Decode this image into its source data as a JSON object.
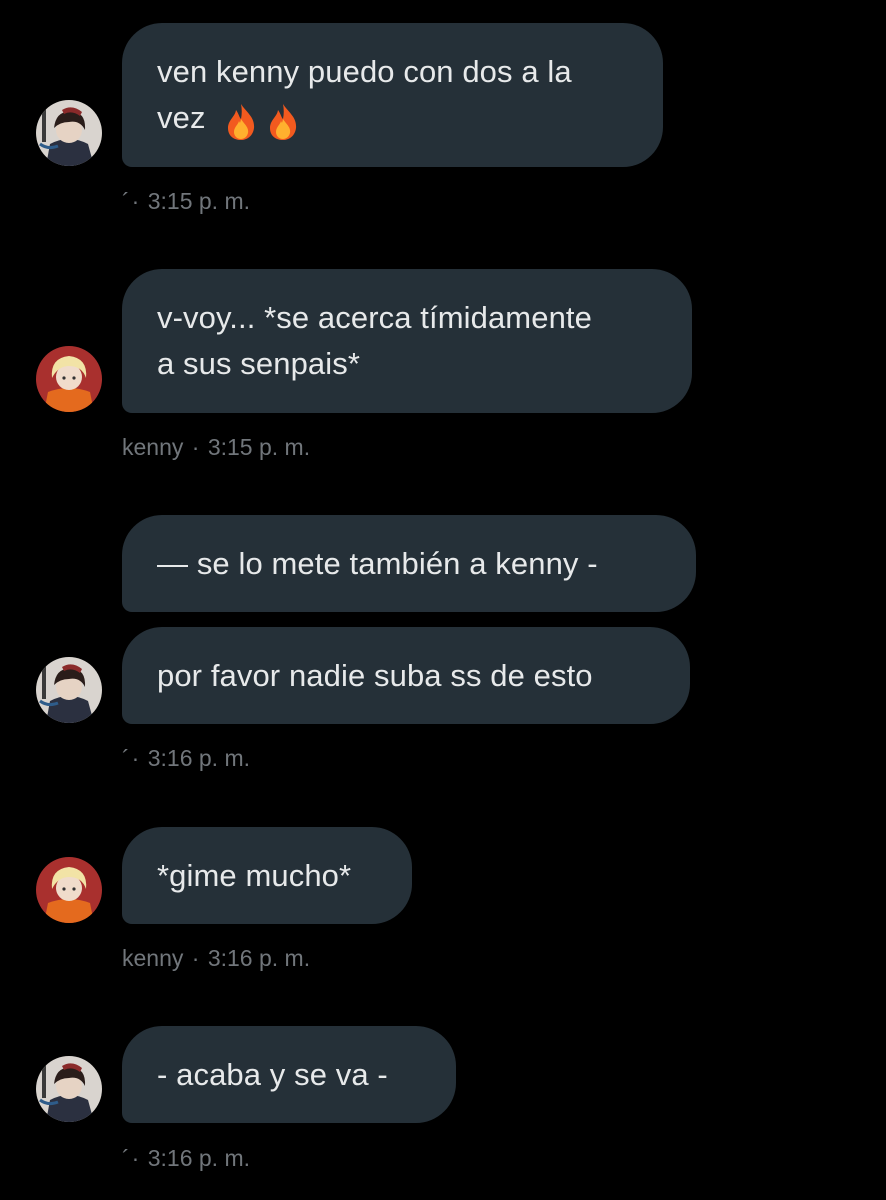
{
  "messages": [
    {
      "sender": "",
      "avatar_icon": "dark-haired-user-avatar-icon",
      "text": "ven kenny puedo con dos a la\nvez",
      "emoji": [
        "fire",
        "fire"
      ],
      "time": "3:15 p. m."
    },
    {
      "sender": "kenny",
      "avatar_icon": "blonde-user-avatar-icon",
      "text": "v-voy... *se acerca tímidamente\na sus senpais*",
      "time": "3:15 p. m."
    },
    {
      "sender": "",
      "avatar_icon": "dark-haired-user-avatar-icon",
      "text": "— se lo mete también a kenny -",
      "time": ""
    },
    {
      "sender": "",
      "avatar_icon": "dark-haired-user-avatar-icon",
      "text": "por favor nadie suba ss de esto",
      "time": "3:16 p. m."
    },
    {
      "sender": "kenny",
      "avatar_icon": "blonde-user-avatar-icon",
      "text": "*gime mucho*",
      "time": "3:16 p. m."
    },
    {
      "sender": "",
      "avatar_icon": "dark-haired-user-avatar-icon",
      "text": "- acaba y se va -",
      "time": "3:16 p. m."
    }
  ],
  "meta_separator": "·",
  "meta_glyph": "´",
  "colors": {
    "background": "#000000",
    "bubble": "#253038",
    "text": "#e7e9ea",
    "meta": "#71767b"
  }
}
